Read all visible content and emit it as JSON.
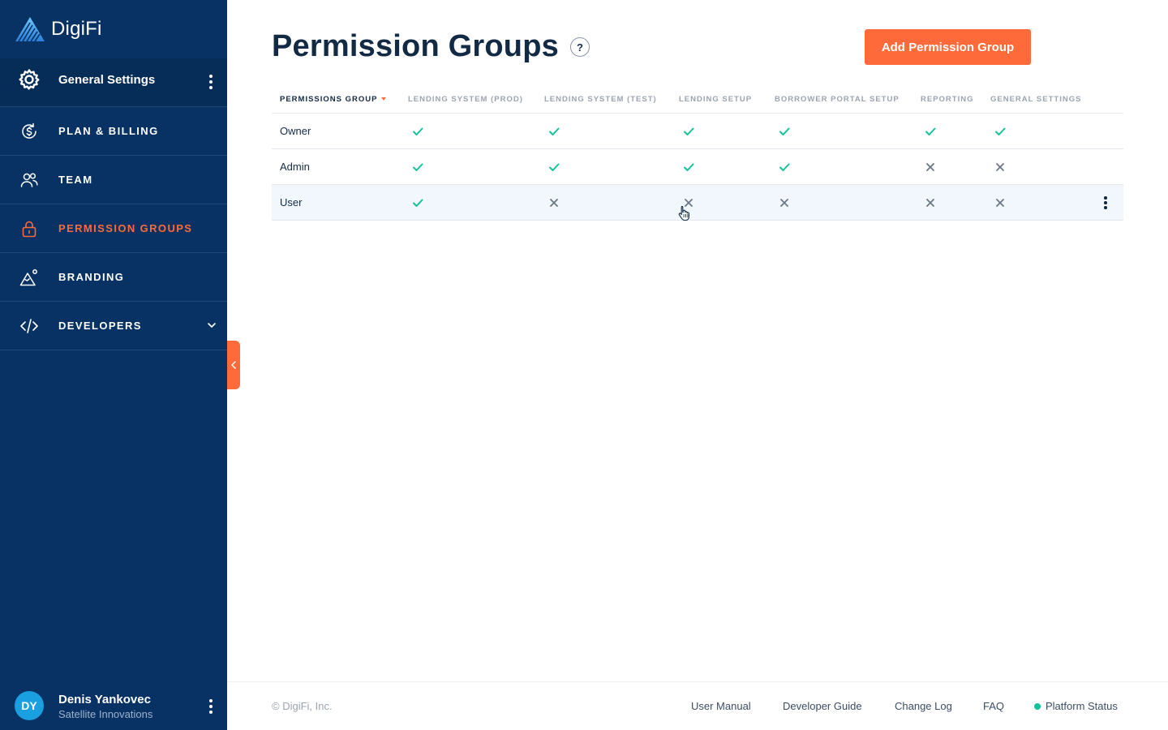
{
  "app": {
    "brand": "DigiFi"
  },
  "sidebar": {
    "section_title": "General Settings",
    "items": [
      {
        "label": "PLAN & BILLING",
        "icon": "dollar-refresh-icon"
      },
      {
        "label": "TEAM",
        "icon": "users-icon"
      },
      {
        "label": "PERMISSION GROUPS",
        "icon": "lock-icon",
        "active": true
      },
      {
        "label": "BRANDING",
        "icon": "mountain-icon"
      },
      {
        "label": "DEVELOPERS",
        "icon": "code-icon",
        "expandable": true
      }
    ],
    "user": {
      "initials": "DY",
      "name": "Denis Yankovec",
      "org": "Satellite Innovations"
    }
  },
  "main": {
    "title": "Permission Groups",
    "help_label": "?",
    "add_button_label": "Add Permission Group",
    "table": {
      "columns": [
        "PERMISSIONS GROUP",
        "LENDING SYSTEM (PROD)",
        "LENDING SYSTEM (TEST)",
        "LENDING SETUP",
        "BORROWER PORTAL SETUP",
        "REPORTING",
        "GENERAL SETTINGS"
      ],
      "sorted_column": "PERMISSIONS GROUP",
      "rows": [
        {
          "name": "Owner",
          "permissions": [
            true,
            true,
            true,
            true,
            true,
            true
          ]
        },
        {
          "name": "Admin",
          "permissions": [
            true,
            true,
            true,
            true,
            false,
            false
          ]
        },
        {
          "name": "User",
          "permissions": [
            true,
            false,
            false,
            false,
            false,
            false
          ]
        }
      ]
    }
  },
  "footer": {
    "copyright": "© DigiFi, Inc.",
    "links": [
      "User Manual",
      "Developer Guide",
      "Change Log",
      "FAQ",
      "Platform Status"
    ]
  },
  "colors": {
    "sidebar": "#073263",
    "accent": "#ff6a3a",
    "check": "#12c29b",
    "cross": "#6b7686",
    "title": "#132a45"
  }
}
